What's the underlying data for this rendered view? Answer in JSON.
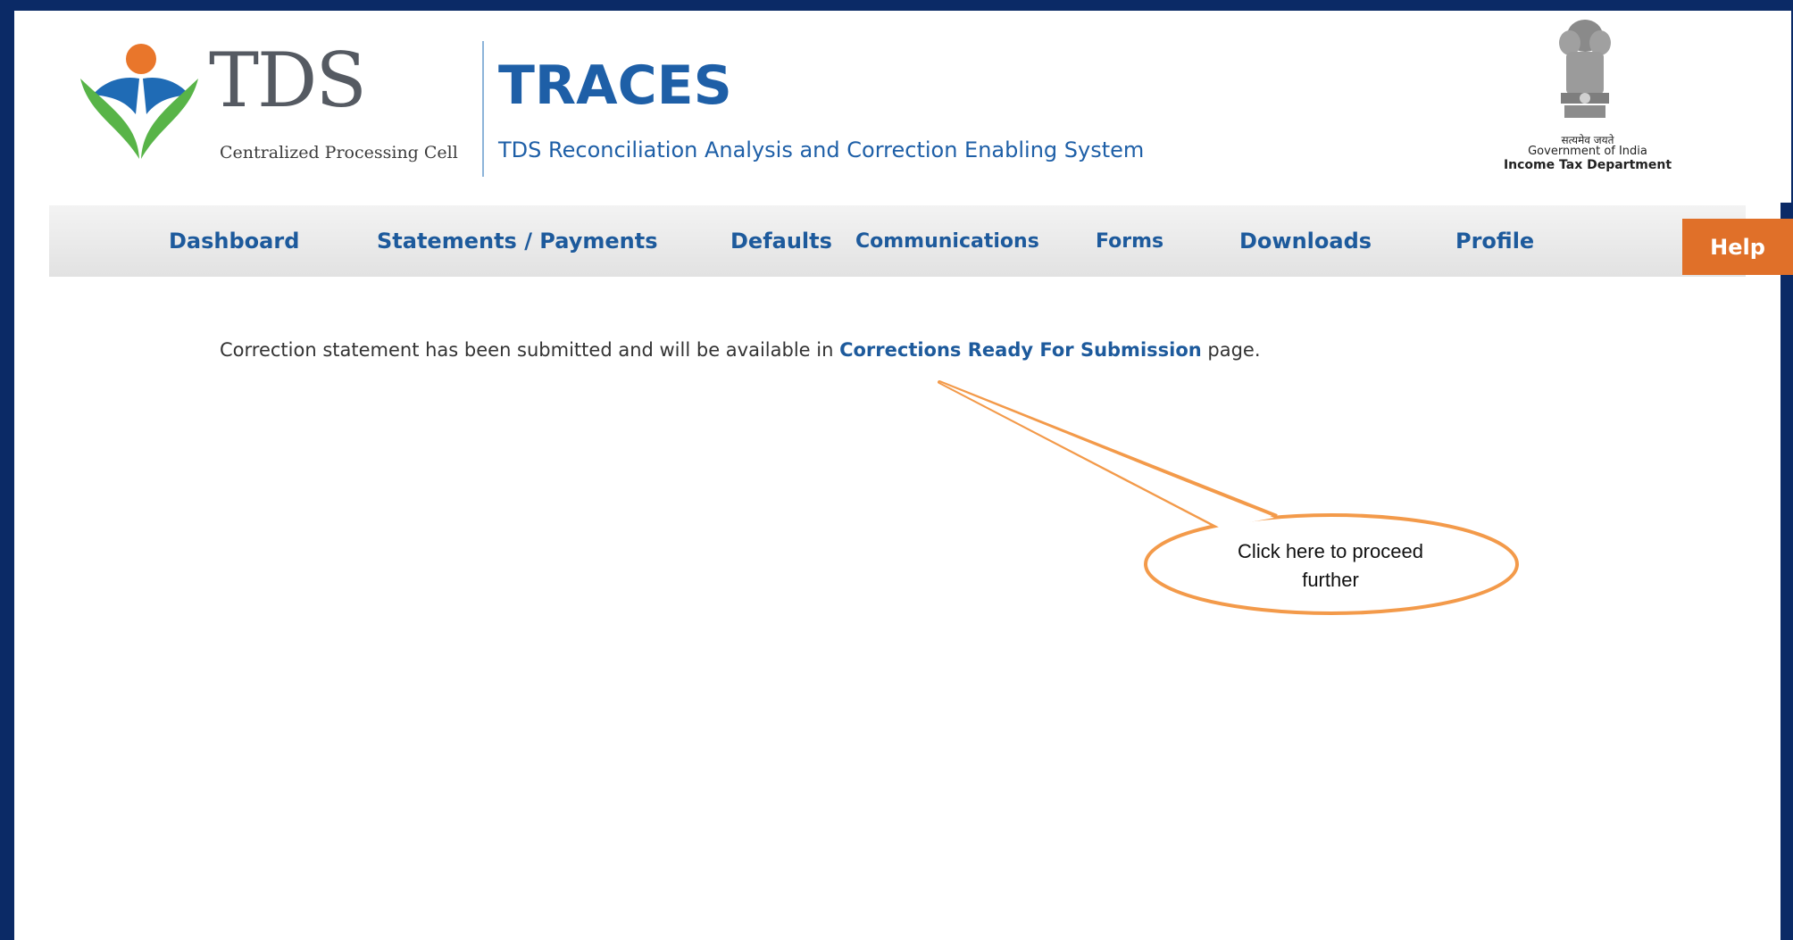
{
  "header": {
    "logo_text": "TDS",
    "logo_subtitle": "Centralized Processing Cell",
    "app_title": "TRACES",
    "app_subtitle": "TDS Reconciliation Analysis and Correction Enabling System",
    "gov_hindi": "सत्यमेव जयते",
    "gov_line1": "Government of India",
    "gov_line2": "Income Tax Department"
  },
  "nav": {
    "items": [
      {
        "label": "Dashboard"
      },
      {
        "label": "Statements / Payments"
      },
      {
        "label": "Defaults"
      },
      {
        "label": "Communications"
      },
      {
        "label": "Forms"
      },
      {
        "label": "Downloads"
      },
      {
        "label": "Profile"
      }
    ],
    "help": "Help"
  },
  "main": {
    "message_before": "Correction statement has been submitted and will be available in ",
    "message_link": "Corrections Ready For Submission",
    "message_after": " page."
  },
  "callout": {
    "line1": "Click here to proceed",
    "line2": "further"
  },
  "colors": {
    "frame": "#0b2a66",
    "brand_blue": "#1e5fa7",
    "help_orange": "#e07029",
    "callout_orange": "#f39a4a"
  }
}
